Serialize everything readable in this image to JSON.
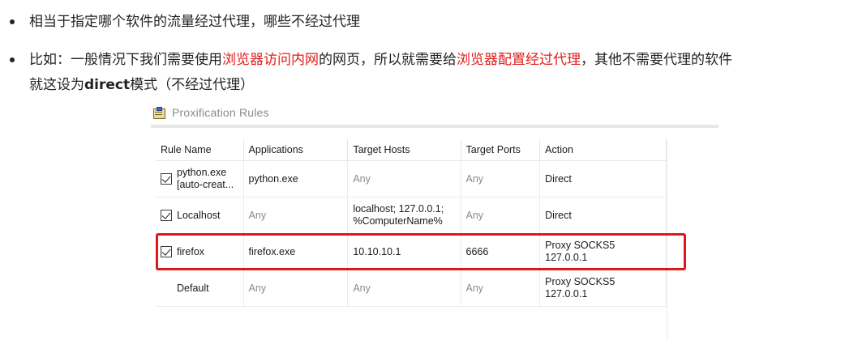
{
  "bullets": [
    {
      "segments": [
        {
          "text": "相当于指定哪个软件的流量经过代理，哪些不经过代理",
          "style": "normal"
        }
      ]
    },
    {
      "segments": [
        {
          "text": "比如：一般情况下我们需要使用",
          "style": "normal"
        },
        {
          "text": "浏览器访问内网",
          "style": "red"
        },
        {
          "text": "的网页，所以就需要给",
          "style": "normal"
        },
        {
          "text": "浏览器配置经过代理",
          "style": "red"
        },
        {
          "text": "，其他不需要代理的软件",
          "style": "normal"
        }
      ],
      "continuation": [
        {
          "text": "就这设为",
          "style": "normal"
        },
        {
          "text": "direct",
          "style": "bold"
        },
        {
          "text": "模式（不经过代理）",
          "style": "normal"
        }
      ]
    }
  ],
  "panel": {
    "title": "Proxification Rules",
    "title_icon": "rules-list-icon",
    "columns": [
      "Rule Name",
      "Applications",
      "Target Hosts",
      "Target Ports",
      "Action"
    ],
    "rows": [
      {
        "checked": true,
        "name": "python.exe\n[auto-creat...",
        "name_line1": "python.exe",
        "name_line2": "[auto-creat...",
        "applications": "python.exe",
        "hosts": "Any",
        "ports": "Any",
        "action": "Direct",
        "highlighted": false
      },
      {
        "checked": true,
        "name": "Localhost",
        "applications": "Any",
        "hosts_line1": "localhost; 127.0.0.1;",
        "hosts_line2": "%ComputerName%",
        "ports": "Any",
        "action": "Direct",
        "highlighted": false
      },
      {
        "checked": true,
        "name": "firefox",
        "applications": "firefox.exe",
        "hosts": "10.10.10.1",
        "ports": "6666",
        "action_line1": "Proxy SOCKS5",
        "action_line2": "127.0.0.1",
        "highlighted": true
      },
      {
        "checked": null,
        "name": "Default",
        "applications": "Any",
        "hosts": "Any",
        "ports": "Any",
        "action_line1": "Proxy SOCKS5",
        "action_line2": "127.0.0.1",
        "highlighted": false
      }
    ]
  },
  "colors": {
    "highlight": "#e01b1b",
    "annotation_box": "#e0161b",
    "muted_text": "#8a8a8a"
  }
}
